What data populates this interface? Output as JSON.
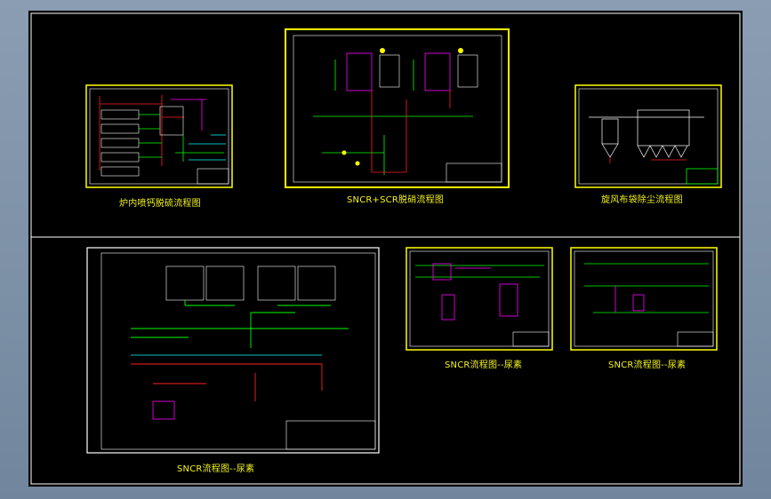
{
  "drawings": [
    {
      "id": "furnace-desulfurization",
      "title": "炉内喷钙脱硫流程图"
    },
    {
      "id": "sncr-scr-denitration",
      "title": "SNCR+SCR脱硝流程图"
    },
    {
      "id": "cyclone-baghouse",
      "title": "旋风布袋除尘流程图"
    },
    {
      "id": "sncr-urea-large",
      "title": "SNCR流程图--尿素"
    },
    {
      "id": "sncr-urea-mid",
      "title": "SNCR流程图--尿素"
    },
    {
      "id": "sncr-urea-right",
      "title": "SNCR流程图--尿素"
    }
  ],
  "colors": {
    "background": "#000000",
    "border": "#ffffff",
    "sheet_frame": "#ffff00",
    "flow_green": "#00ff00",
    "flow_red": "#ff2020",
    "flow_magenta": "#ff00ff",
    "flow_cyan": "#00ffff",
    "title_text": "#f2f21a"
  }
}
